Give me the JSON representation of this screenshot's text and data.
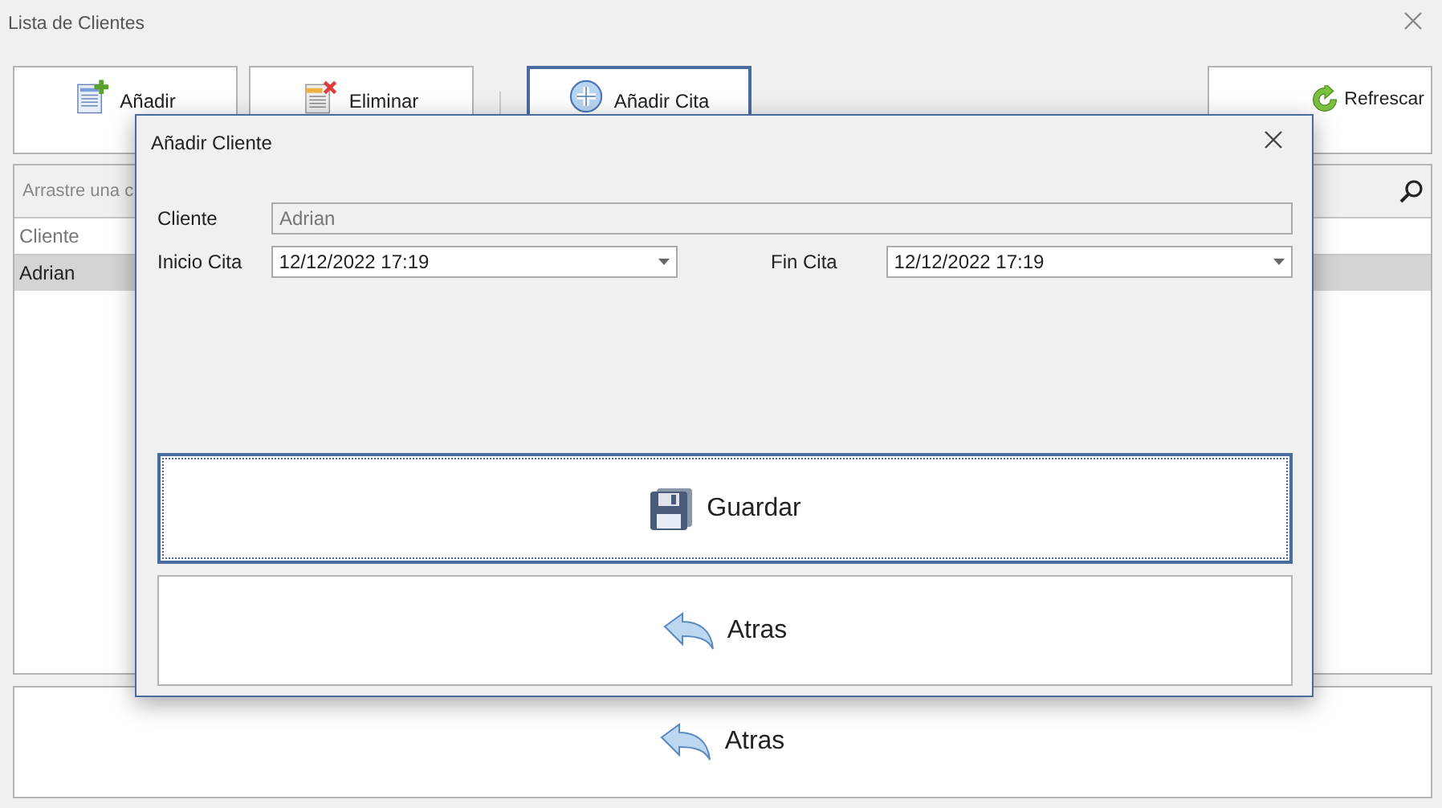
{
  "window": {
    "title": "Lista de Clientes"
  },
  "toolbar": {
    "groups": [
      {
        "buttons": [
          {
            "label": "Añadir",
            "kind": "add",
            "focused": false
          },
          {
            "label": "Eliminar",
            "kind": "delete",
            "focused": false
          }
        ]
      },
      {
        "buttons": [
          {
            "label": "Añadir Cita",
            "kind": "appointment",
            "focused": true
          }
        ]
      }
    ],
    "right_buttons": [
      {
        "label": "Refrescar",
        "kind": "refresh",
        "focused": false
      }
    ]
  },
  "grid": {
    "group_panel_hint": "Arrastre una c",
    "columns": [
      "Cliente"
    ],
    "rows": [
      {
        "cells": [
          "Adrian"
        ],
        "selected": true
      }
    ]
  },
  "bottom_button": {
    "label": "Atras",
    "kind": "back"
  },
  "dialog": {
    "title": "Añadir Cliente",
    "rows": [
      [
        {
          "label": "Cliente",
          "value": "Adrian",
          "kind": "text",
          "disabled": true
        }
      ],
      [
        {
          "label": "Inicio Cita",
          "value": "12/12/2022 17:19",
          "kind": "datetime",
          "disabled": false
        },
        {
          "label": "Fin Cita",
          "value": "12/12/2022 17:19",
          "kind": "datetime",
          "disabled": false
        }
      ]
    ],
    "buttons": [
      {
        "label": "Guardar",
        "kind": "save",
        "focused": true
      },
      {
        "label": "Atras",
        "kind": "back",
        "focused": false
      }
    ]
  }
}
